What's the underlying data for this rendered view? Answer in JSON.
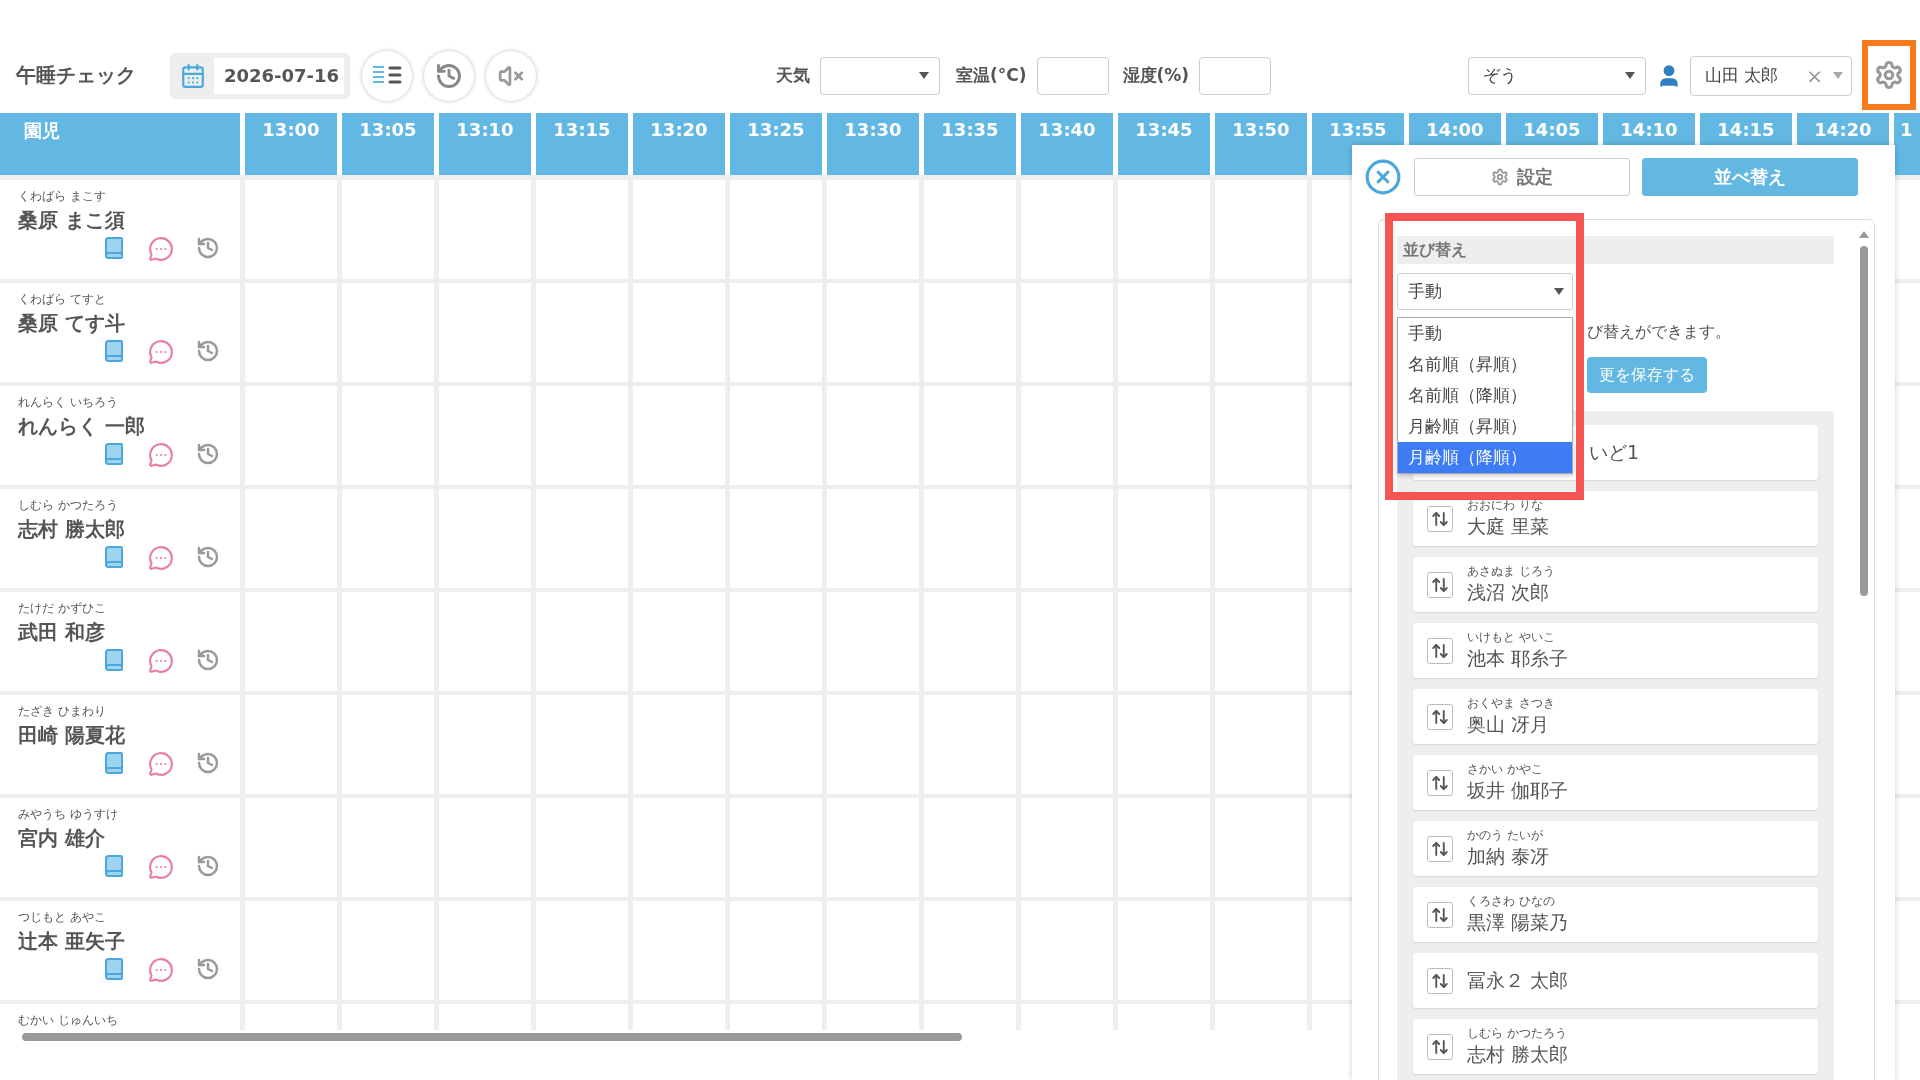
{
  "header": {
    "title": "午睡チェック",
    "date": "2026-07-16",
    "weather_label": "天気",
    "temperature_label": "室温(°C)",
    "humidity_label": "湿度(%)",
    "class_select": "ぞう",
    "user": "山田 太郎",
    "clear_user": "×"
  },
  "table": {
    "name_column": "園児",
    "time_columns": [
      "13:00",
      "13:05",
      "13:10",
      "13:15",
      "13:20",
      "13:25",
      "13:30",
      "13:35",
      "13:40",
      "13:45",
      "13:50",
      "13:55",
      "14:00",
      "14:05",
      "14:10",
      "14:15",
      "14:20",
      "1"
    ],
    "children": [
      {
        "kana": "くわばら まこす",
        "name": "桑原 まこ須"
      },
      {
        "kana": "くわばら てすと",
        "name": "桑原 てす斗"
      },
      {
        "kana": "れんらく いちろう",
        "name": "れんらく 一郎"
      },
      {
        "kana": "しむら かつたろう",
        "name": "志村 勝太郎"
      },
      {
        "kana": "たけだ かずひこ",
        "name": "武田 和彦"
      },
      {
        "kana": "たざき ひまわり",
        "name": "田崎 陽夏花"
      },
      {
        "kana": "みやうち ゆうすけ",
        "name": "宮内 雄介"
      },
      {
        "kana": "つじもと あやこ",
        "name": "辻本 亜矢子"
      },
      {
        "kana": "むかい じゅんいち"
      }
    ]
  },
  "panel": {
    "tabs": [
      {
        "label": "設定",
        "kind": "settings",
        "selected": false
      },
      {
        "label": "並べ替え",
        "kind": "plain",
        "selected": true
      }
    ],
    "section_title": "並び替え",
    "sort_select": "手動",
    "sort_options": [
      {
        "label": "手動",
        "selected": false
      },
      {
        "label": "名前順（昇順）",
        "selected": false
      },
      {
        "label": "名前順（降順）",
        "selected": false
      },
      {
        "label": "月齢順（昇順）",
        "selected": false
      },
      {
        "label": "月齢順（降順）",
        "selected": true
      }
    ],
    "description": "び替えができます。",
    "save_button": "更を保存する",
    "list": [
      {
        "name": "いど1"
      },
      {
        "kana": "おおにわ りな",
        "name": "大庭 里菜"
      },
      {
        "kana": "あさぬま じろう",
        "name": "浅沼 次郎"
      },
      {
        "kana": "いけもと やいこ",
        "name": "池本 耶糸子"
      },
      {
        "kana": "おくやま さつき",
        "name": "奥山 冴月"
      },
      {
        "kana": "さかい かやこ",
        "name": "坂井 伽耶子"
      },
      {
        "kana": "かのう たいが",
        "name": "加納 泰冴"
      },
      {
        "kana": "くろさわ ひなの",
        "name": "黒澤 陽菜乃"
      },
      {
        "name": "冨永２ 太郎"
      },
      {
        "kana": "しむら かつたろう",
        "name": "志村 勝太郎"
      }
    ]
  }
}
